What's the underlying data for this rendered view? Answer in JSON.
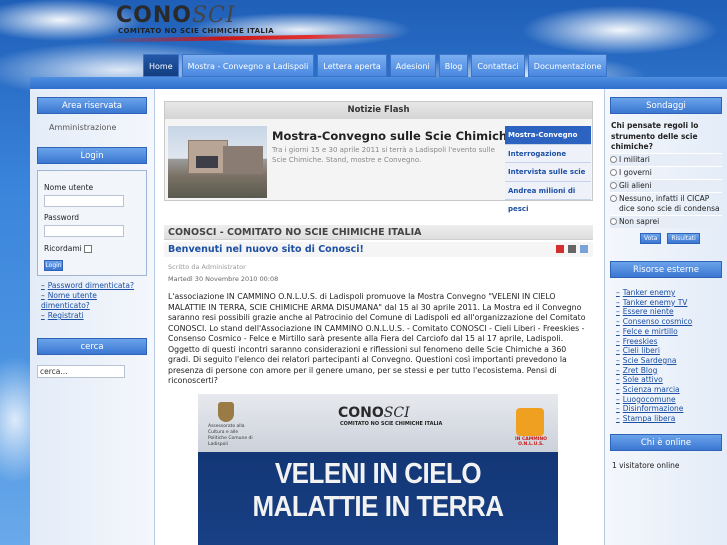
{
  "logo": {
    "title_part1": "CONO",
    "title_part2": "SCI",
    "subtitle": "COMITATO NO SCIE CHIMICHE ITALIA"
  },
  "nav": [
    "Home",
    "Mostra - Convegno a Ladispoli",
    "Lettera aperta",
    "Adesioni",
    "Blog",
    "Contattaci",
    "Documentazione"
  ],
  "left": {
    "reserved_title": "Area riservata",
    "admin_link": "Amministrazione",
    "login_title": "Login",
    "username_label": "Nome utente",
    "password_label": "Password",
    "remember_label": "Ricordami",
    "login_button": "Login",
    "links": [
      "Password dimenticata?",
      "Nome utente dimenticato?",
      "Registrati"
    ],
    "search_title": "cerca",
    "search_value": "cerca..."
  },
  "flash": {
    "title": "Notizie Flash",
    "headline": "Mostra-Convegno sulle Scie Chimiche.",
    "text": "Tra i giorni 15 e 30 aprile 2011 si terrà a Ladispoli l'evento sulle Scie Chimiche. Stand, mostre e Convegno.",
    "items": [
      "Mostra-Convegno sulle",
      "Interrogazione",
      "Intervista sulle scie",
      "Andrea milioni di pesci"
    ]
  },
  "article": {
    "section": "CONOSCI - COMITATO NO SCIE CHIMICHE ITALIA",
    "title": "Benvenuti nel nuovo sito di Conosci!",
    "author": "Scritto da Administrator",
    "date": "Martedì 30 Novembre 2010 00:08",
    "body": "L'associazione IN CAMMINO O.N.L.U.S. di Ladispoli promuove la Mostra Convegno \"VELENI IN CIELO MALATTIE IN TERRA, SCIE CHIMICHE ARMA  DISUMANA\" dal 15 al 30 aprile 2011. La Mostra ed il Convegno saranno resi possibili grazie anche al Patrocinio del Comune di Ladispoli ed all'organizzazione del Comitato CONOSCI. Lo stand dell'Associazione IN CAMMINO O.N.L.U.S. - Comitato CONOSCI - Cieli Liberi - Freeskies -  Consenso Cosmico -  Felce e Mirtillo sarà presente alla Fiera del Carciofo dal 15 al 17 aprile, Ladispoli. Oggetto di questi incontri saranno considerazioni e riflessioni sul fenomeno delle Scie Chimiche a 360 gradi. Di seguito l'elenco dei relatori partecipanti al Convegno. Questioni così importanti prevedono la presenza di persone con amore per il genere umano, per se stessi e per tutto l'ecosistema. Pensi di riconoscerti?",
    "poster": {
      "logo_part1": "CONO",
      "logo_part2": "SCI",
      "logo_sub": "COMITATO NO SCIE CHIMICHE ITALIA",
      "left_text": "Assessorato alla Cultura e alle Politiche Comune di Ladispoli",
      "badge_text": "IN CAMMINO O.N.L.U.S.",
      "line1": "VELENI IN CIELO",
      "line2": "MALATTIE IN TERRA"
    }
  },
  "right": {
    "poll_title": "Sondaggi",
    "poll_question": "Chi pensate regoli lo strumento delle scie chimiche?",
    "poll_options": [
      "I militari",
      "I governi",
      "Gli alieni",
      "Nessuno, infatti il CICAP dice sono scie di condensa",
      "Non saprei"
    ],
    "vote_button": "Vota",
    "results_button": "Risultati",
    "resources_title": "Risorse esterne",
    "resources": [
      "Tanker enemy",
      "Tanker enemy TV",
      "Essere niente",
      "Consenso cosmico",
      "Felce e mirtillo",
      "Freeskies",
      "Cieli liberi",
      "Scie Sardegna",
      "Zret Blog",
      "Sole attivo",
      "Scienza marcia",
      "Luogocomune",
      "Disinformazione",
      "Stampa libera"
    ],
    "online_title": "Chi è online",
    "online_text": "1 visitatore online"
  }
}
